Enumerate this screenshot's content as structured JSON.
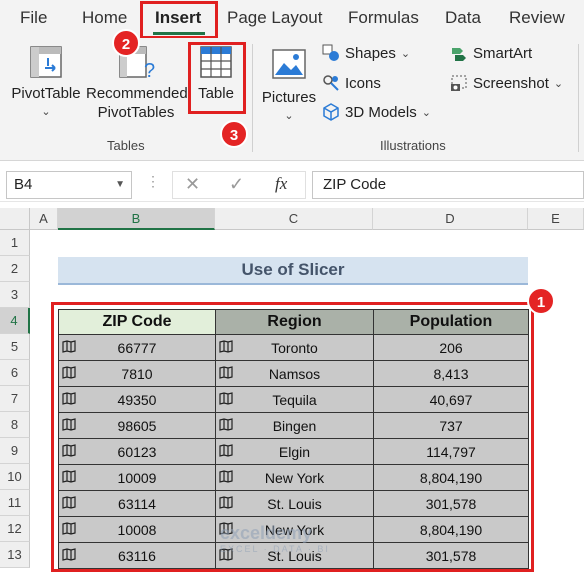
{
  "tabs": [
    "File",
    "Home",
    "Insert",
    "Page Layout",
    "Formulas",
    "Data",
    "Review"
  ],
  "ribbon": {
    "pivot_table": "PivotTable",
    "recommended_line1": "Recommended",
    "recommended_line2": "PivotTables",
    "table": "Table",
    "tables_group": "Tables",
    "pictures": "Pictures",
    "shapes": "Shapes",
    "icons": "Icons",
    "models_3d": "3D Models",
    "smartart": "SmartArt",
    "screenshot": "Screenshot",
    "illustrations_group": "Illustrations"
  },
  "formula_bar": {
    "name_box": "B4",
    "formula": "ZIP Code"
  },
  "columns": [
    "A",
    "B",
    "C",
    "D",
    "E"
  ],
  "rows": [
    "1",
    "2",
    "3",
    "4",
    "5",
    "6",
    "7",
    "8",
    "9",
    "10",
    "11",
    "12",
    "13"
  ],
  "sheet": {
    "title": "Use of Slicer",
    "headers": [
      "ZIP Code",
      "Region",
      "Population"
    ],
    "data": [
      [
        "66777",
        "Toronto",
        "206"
      ],
      [
        "7810",
        "Namsos",
        "8,413"
      ],
      [
        "49350",
        "Tequila",
        "40,697"
      ],
      [
        "98605",
        "Bingen",
        "737"
      ],
      [
        "60123",
        "Elgin",
        "114,797"
      ],
      [
        "10009",
        "New York",
        "8,804,190"
      ],
      [
        "63114",
        "St. Louis",
        "301,578"
      ],
      [
        "10008",
        "New York",
        "8,804,190"
      ],
      [
        "63116",
        "St. Louis",
        "301,578"
      ]
    ]
  },
  "callouts": [
    "2",
    "3",
    "1"
  ],
  "watermark": {
    "name": "exceldemy",
    "tagline": "EXCEL · DATA · BI"
  },
  "colors": {
    "accent": "#217346",
    "callout": "#e42424",
    "title_fill": "#d6e3f0"
  }
}
